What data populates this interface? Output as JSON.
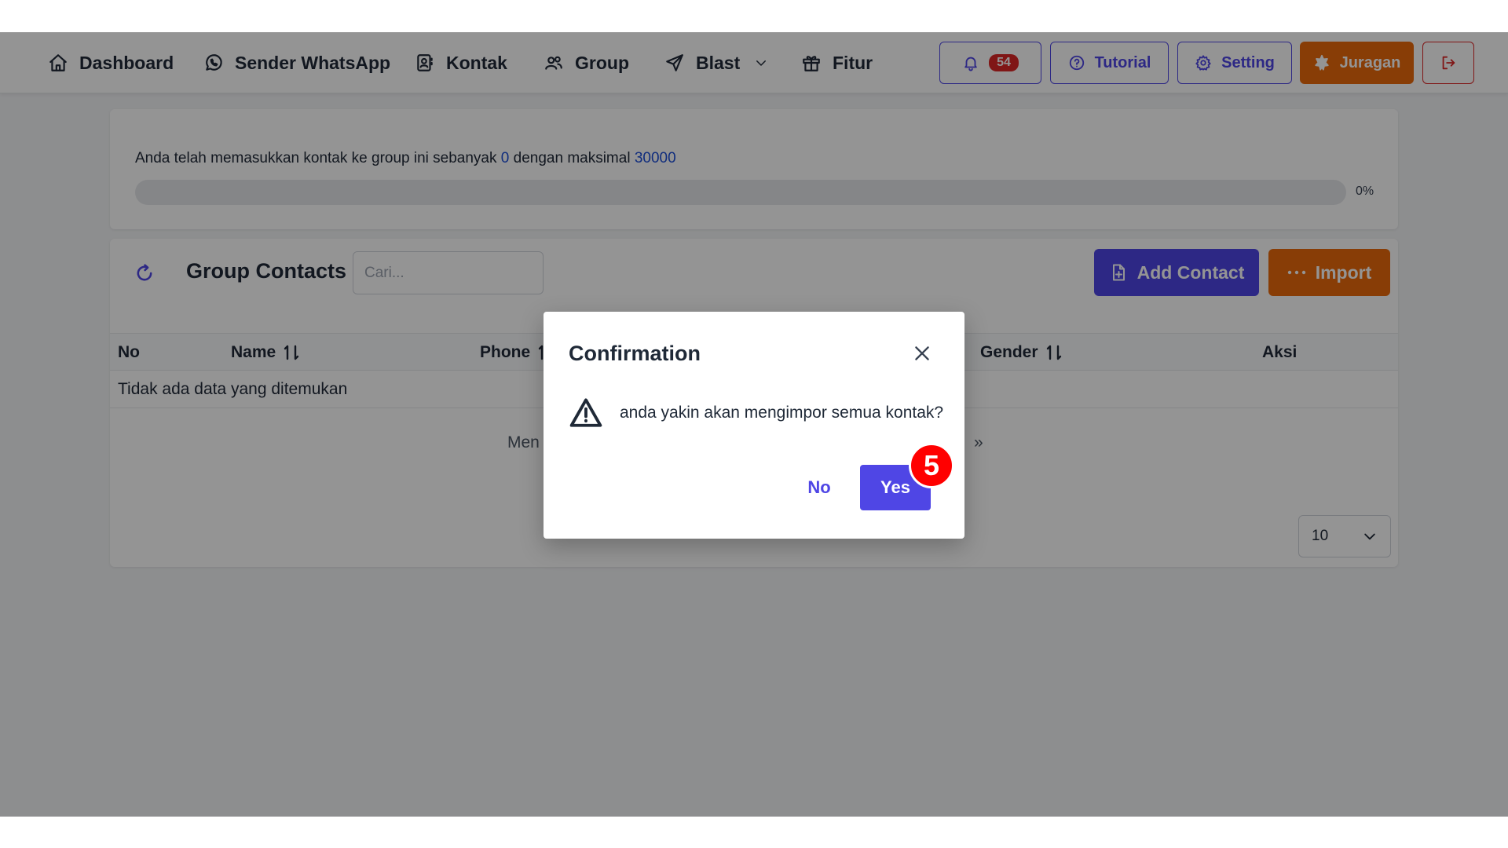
{
  "nav": {
    "items": [
      {
        "label": "Dashboard",
        "icon": "home-icon"
      },
      {
        "label": "Sender WhatsApp",
        "icon": "whatsapp-icon"
      },
      {
        "label": "Kontak",
        "icon": "contact-book-icon"
      },
      {
        "label": "Group",
        "icon": "users-icon"
      },
      {
        "label": "Blast",
        "icon": "send-icon"
      },
      {
        "label": "Fitur",
        "icon": "gift-icon"
      }
    ],
    "notifications_count": "54",
    "tutorial_label": "Tutorial",
    "setting_label": "Setting",
    "juragan_label": "Juragan"
  },
  "quota": {
    "text_before": "Anda telah memasukkan kontak ke group ini sebanyak ",
    "current": "0",
    "text_middle": " dengan maksimal ",
    "max": "30000",
    "progress_label": "0%",
    "progress_fraction": 0
  },
  "contacts": {
    "title": "Group Contacts",
    "search_placeholder": "Cari...",
    "add_label": "Add Contact",
    "import_label": "Import",
    "columns": [
      "No",
      "Name",
      "Phone",
      "Gender",
      "Aksi"
    ],
    "empty_message": "Tidak ada data yang ditemukan",
    "pagination_text": "Men",
    "pagination_next": "»",
    "page_size": "10"
  },
  "modal": {
    "title": "Confirmation",
    "message": "anda yakin akan mengimpor semua kontak?",
    "no_label": "No",
    "yes_label": "Yes"
  },
  "annotation": {
    "step": "5"
  },
  "colors": {
    "primary": "#4f46e5",
    "orange": "#ea6a0c",
    "danger": "#dc2626",
    "step_badge": "#ff0000"
  }
}
